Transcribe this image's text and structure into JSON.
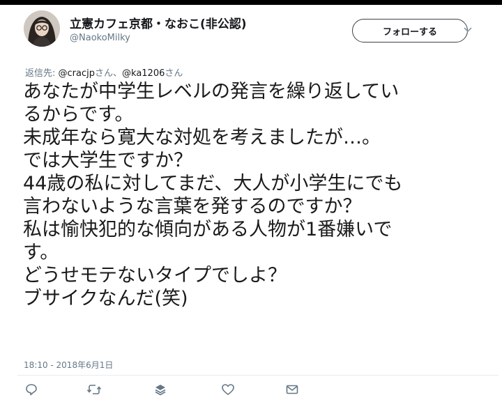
{
  "author": {
    "display_name": "立憲カフェ京都・なおこ(非公認)",
    "handle": "@NaokoMilky"
  },
  "follow_button": {
    "label": "フォローする"
  },
  "reply_to": {
    "prefix": "返信先: ",
    "mention_1": "@cracjp",
    "honorific_1": "さん、",
    "mention_2": "@ka1206",
    "honorific_2": "さん"
  },
  "tweet": {
    "lines": [
      "あなたが中学生レベルの発言を繰り返してい",
      "るからです。",
      "未成年なら寛大な対処を考えましたが…。",
      "では大学生ですか？",
      "44歳の私に対してまだ、大人が小学生にでも",
      "言わないような言葉を発するのですか？",
      "私は愉快犯的な傾向がある人物が1番嫌いで",
      "す。",
      "どうせモテないタイプでしよ？",
      "ブサイクなんだ(笑)"
    ],
    "timestamp": "18:10 - 2018年6月1日"
  },
  "icons": {
    "caret": "chevron-down-icon",
    "reply": "reply-icon",
    "retweet": "retweet-icon",
    "stack": "layers-icon",
    "like": "heart-icon",
    "message": "mail-icon"
  },
  "colors": {
    "text": "#14171a",
    "secondary": "#657786",
    "divider": "#e6ecf0",
    "icon": "#657786"
  }
}
